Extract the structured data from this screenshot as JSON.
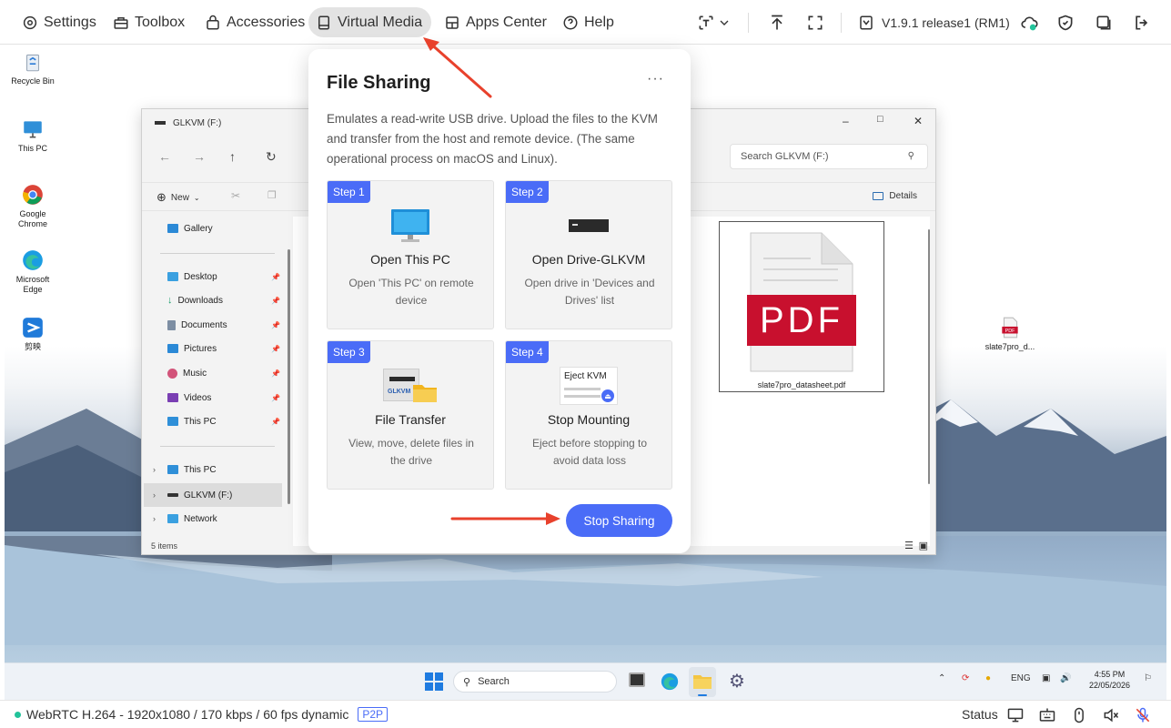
{
  "topbar": {
    "menu": [
      {
        "label": "Settings",
        "icon": "gear-icon"
      },
      {
        "label": "Toolbox",
        "icon": "toolbox-icon"
      },
      {
        "label": "Accessories",
        "icon": "bag-icon"
      },
      {
        "label": "Virtual Media",
        "icon": "drive-icon",
        "active": true
      },
      {
        "label": "Apps Center",
        "icon": "grid-icon"
      },
      {
        "label": "Help",
        "icon": "help-icon"
      }
    ],
    "version": "V1.9.1 release1 (RM1)"
  },
  "desktop_icons": [
    {
      "label": "Recycle Bin",
      "icon": "recycle-bin-icon"
    },
    {
      "label": "This PC",
      "icon": "monitor-icon"
    },
    {
      "label": "Google Chrome",
      "icon": "chrome-icon"
    },
    {
      "label": "Microsoft Edge",
      "icon": "edge-icon"
    },
    {
      "label": "剪映",
      "icon": "capcut-icon"
    },
    {
      "label": "slate7pro_d...",
      "icon": "pdf-file-icon"
    }
  ],
  "explorer": {
    "title": "GLKVM (F:)",
    "search_placeholder": "Search GLKVM (F:)",
    "new_label": "New",
    "details_label": "Details",
    "sidebar": {
      "gallery": "Gallery",
      "quick": [
        "Desktop",
        "Downloads",
        "Documents",
        "Pictures",
        "Music",
        "Videos",
        "This PC"
      ],
      "tree": [
        "This PC",
        "GLKVM (F:)",
        "Network"
      ]
    },
    "file_name": "slate7pro_datasheet.pdf",
    "file_badge": "PDF",
    "status": "5 items"
  },
  "popup": {
    "title": "File Sharing",
    "description": "Emulates a read-write USB drive. Upload the files to the KVM and transfer from the host and remote device. (The same operational process on macOS and Linux).",
    "steps": [
      {
        "badge": "Step 1",
        "title": "Open This PC",
        "desc": "Open 'This PC' on remote device"
      },
      {
        "badge": "Step 2",
        "title": "Open Drive-GLKVM",
        "desc": "Open drive in 'Devices and Drives' list"
      },
      {
        "badge": "Step 3",
        "title": "File Transfer",
        "desc": "View, move, delete files in the drive",
        "graphic_label": "GLKVM"
      },
      {
        "badge": "Step 4",
        "title": "Stop Mounting",
        "desc": "Eject before stopping to avoid data loss",
        "graphic_label": "Eject KVM"
      }
    ],
    "stop_button": "Stop Sharing",
    "accent": "#4a6cf7"
  },
  "taskbar": {
    "search_placeholder": "Search",
    "lang": "ENG",
    "time": "4:55 PM",
    "date": "22/05/2026"
  },
  "statusbar": {
    "stream": "WebRTC H.264 - 1920x1080 /  170 kbps / 60 fps dynamic",
    "p2p": "P2P",
    "status": "Status"
  }
}
